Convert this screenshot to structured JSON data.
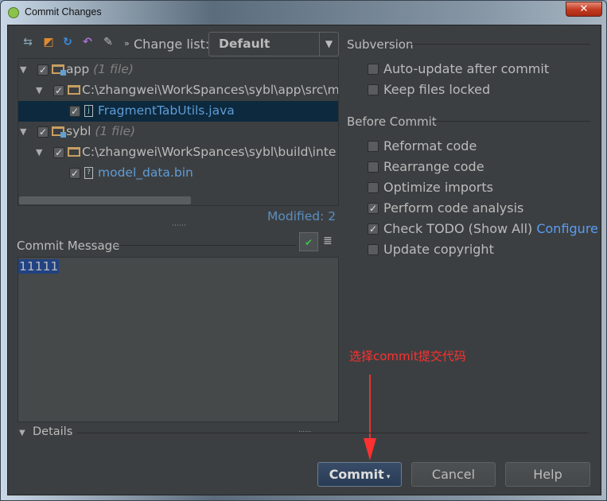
{
  "window": {
    "title": "Commit Changes",
    "close_icon": "close-icon"
  },
  "toolbar": {
    "icons": [
      "show-diff-icon",
      "move-to-changelist-icon",
      "refresh-icon",
      "rollback-icon",
      "edit-source-icon"
    ],
    "more": "»",
    "changelist_label": "Change list:",
    "changelist_value": "Default"
  },
  "tree": {
    "rows": [
      {
        "label": "app",
        "count": "(1 file)",
        "checked": true
      },
      {
        "label": "C:\\zhangwei\\WorkSpances\\sybl\\app\\src\\m",
        "checked": true
      },
      {
        "label": "FragmentTabUtils.java",
        "checked": true,
        "selected": true
      },
      {
        "label": "sybl",
        "count": "(1 file)",
        "checked": true
      },
      {
        "label": "C:\\zhangwei\\WorkSpances\\sybl\\build\\inte",
        "checked": true
      },
      {
        "label": "model_data.bin",
        "checked": true
      }
    ]
  },
  "modified": "Modified: 2",
  "commit_message": {
    "label": "Commit Message",
    "value": "11111"
  },
  "subversion": {
    "title": "Subversion",
    "options": [
      {
        "label": "Auto-update after commit",
        "checked": false
      },
      {
        "label": "Keep files locked",
        "checked": false
      }
    ]
  },
  "before_commit": {
    "title": "Before Commit",
    "options": [
      {
        "label": "Reformat code",
        "checked": false
      },
      {
        "label": "Rearrange code",
        "checked": false
      },
      {
        "label": "Optimize imports",
        "checked": false
      },
      {
        "label": "Perform code analysis",
        "checked": true
      },
      {
        "label": "Check TODO (Show All)",
        "checked": true,
        "link": "Configure"
      },
      {
        "label": "Update copyright",
        "checked": false
      }
    ]
  },
  "annotation": {
    "text": "选择commit提交代码",
    "color": "#ff3030"
  },
  "details": {
    "label": "Details"
  },
  "buttons": {
    "commit": "Commit",
    "cancel": "Cancel",
    "help": "Help"
  },
  "colors": {
    "background": "#3c3f41",
    "selection": "#0d293e",
    "link": "#589df6",
    "text_selection": "#214283"
  }
}
